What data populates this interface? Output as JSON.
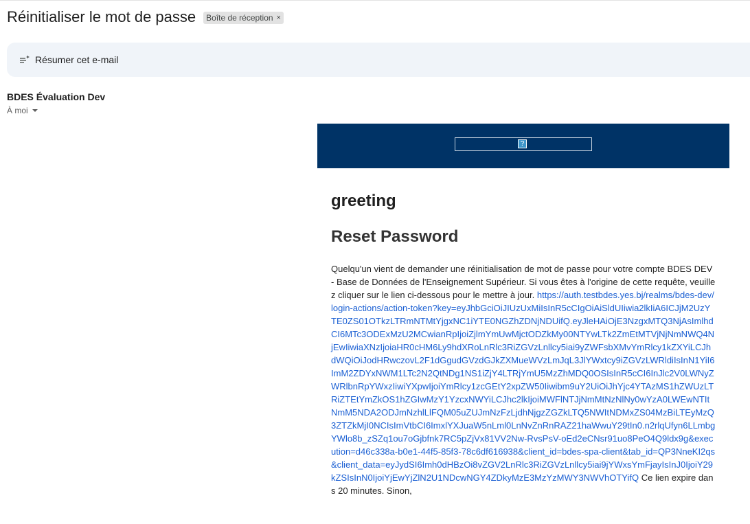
{
  "subject": "Réinitialiser le mot de passe",
  "label_chip": {
    "text": "Boîte de réception",
    "close": "×"
  },
  "summary_button": {
    "label": "Résumer cet e-mail",
    "icon": "summarize-sparkle-icon"
  },
  "sender": {
    "name": "BDES Évaluation Dev",
    "recipient": "À moi"
  },
  "email": {
    "header_bg": "#003366",
    "logo_placeholder": "?",
    "greeting": "greeting",
    "title": "Reset Password",
    "message_before_link": "Quelqu'un vient de demander une réinitialisation de mot de passe pour votre compte BDES DEV - Base de Données de l'Enseignement Supérieur. Si vous êtes à l'origine de cette requête, veuillez cliquer sur le lien ci-dessous pour le mettre à jour.",
    "reset_link": "https://auth.testbdes.yes.bj/realms/bdes-dev/login-actions/action-token?key=eyJhbGciOiJIUzUxMiIsInR5cCIgOiAiSldUIiwia2lkIiA6ICJjM2UzYTE0ZS01OTkzLTRmNTMtYjgxNC1iYTE0NGZhZDNjNDUifQ.eyJleHAiOjE3NzgxMTQ3NjAsImlhdCI6MTc3ODExMzU2MCwianRpIjoiZjlmYmUwMjctODZkMy00NTYwLTk2ZmEtMTVjNjNmNWQ4NjEwIiwiaXNzIjoiaHR0cHM6Ly9hdXRoLnRlc3RiZGVzLnllcy5iai9yZWFsbXMvYmRlcy1kZXYiLCJhdWQiOiJodHRwczovL2F1dGgudGVzdGJkZXMueWVzLmJqL3JlYWxtcy9iZGVzLWRldiIsInN1YiI6ImM2ZDYxNWM1LTc2N2QtNDg1NS1iZjY4LTRjYmU5MzZhMDQ0OSIsInR5cCI6InJlc2V0LWNyZWRlbnRpYWxzIiwiYXpwIjoiYmRlcy1zcGEtY2xpZW50Iiwibm9uY2UiOiJhYjc4YTAzMS1hZWUzLTRiZTEtYmZkOS1hZGIwMzY1YzcxNWYiLCJhc2lkIjoiMWFlNTJjNmMtNzNlNy0wYzA0LWEwNTItNmM5NDA2ODJmNzhlLlFQM05uZUJmNzFzLjdhNjgzZGZkLTQ5NWItNDMxZS04MzBiLTEyMzQ3ZTZkMjI0NCIsImVtbCI6ImxlYXJuaW5nLml0LnNvZnRnRAZ21haWwuY29tIn0.n2rlqUfyn6LLmbgYWlo8b_zSZq1ou7oGjbfnk7RC5pZjVx81VV2Nw-RvsPsV-oEd2eCNsr91uo8PeO4Q9ldx9g&execution=d46c338a-b0e1-44f5-85f3-78c6df616938&client_id=bdes-spa-client&tab_id=QP3NneKI2qs&client_data=eyJydSI6Imh0dHBzOi8vZGV2LnRlc3RiZGVzLnllcy5iai9jYWxsYmFjayIsInJ0IjoiY29kZSIsInN0IjoiYjEwYjZlN2U1NDcwNGY4ZDkyMzE3MzYzMWY3NWVhOTYifQ",
    "message_after_link": "Ce lien expire dans 20 minutes. Sinon,"
  }
}
